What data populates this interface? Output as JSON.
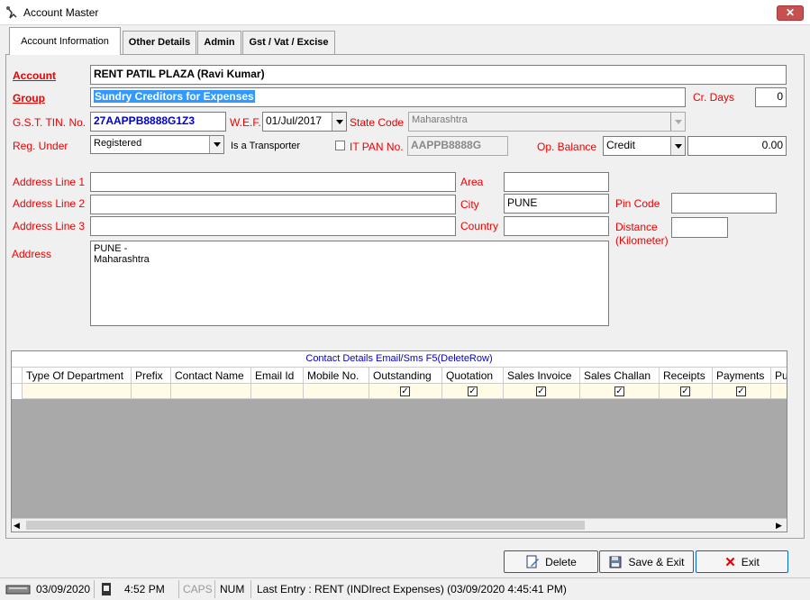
{
  "window": {
    "title": "Account Master",
    "close_label": "✕"
  },
  "tabs": [
    {
      "label": "Account Information"
    },
    {
      "label": "Other Details"
    },
    {
      "label": "Admin"
    },
    {
      "label": "Gst / Vat / Excise"
    }
  ],
  "form": {
    "account_label": "Account",
    "account_value": "RENT PATIL PLAZA (Ravi Kumar)",
    "group_label": "Group",
    "group_value": "Sundry Creditors for Expenses",
    "cr_days_label": "Cr. Days",
    "cr_days_value": "0",
    "gst_label": "G.S.T. TIN. No.",
    "gst_value": "27AAPPB8888G1Z3",
    "wef_label": "W.E.F.",
    "wef_value": "01/Jul/2017",
    "state_code_label": "State Code",
    "state_code_value": "Maharashtra",
    "reg_under_label": "Reg. Under",
    "reg_under_value": "Registered",
    "transporter_label": "Is a Transporter",
    "it_pan_label": "IT PAN No.",
    "it_pan_value": "AAPPB8888G",
    "op_balance_label": "Op. Balance",
    "op_balance_type": "Credit",
    "op_balance_value": "0.00",
    "address1_label": "Address Line 1",
    "address1_value": "",
    "address2_label": "Address Line 2",
    "address2_value": "",
    "address3_label": "Address Line 3",
    "address3_value": "",
    "area_label": "Area",
    "area_value": "",
    "city_label": "City",
    "city_value": "PUNE",
    "country_label": "Country",
    "country_value": "",
    "pincode_label": "Pin Code",
    "pincode_value": "",
    "distance_label": "Distance",
    "distance_unit_label": "(Kilometer)",
    "distance_value": "",
    "address_label": "Address",
    "address_line1": "PUNE -",
    "address_line2": "Maharashtra"
  },
  "contacts": {
    "title": "Contact Details Email/Sms F5(DeleteRow)",
    "columns": [
      "Type Of Department",
      "Prefix",
      "Contact Name",
      "Email Id",
      "Mobile No.",
      "Outstanding",
      "Quotation",
      "Sales Invoice",
      "Sales Challan",
      "Receipts",
      "Payments",
      "Pu"
    ]
  },
  "buttons": {
    "delete": "Delete",
    "save_exit": "Save & Exit",
    "exit": "Exit"
  },
  "status": {
    "date": "03/09/2020",
    "time": "4:52 PM",
    "caps": "CAPS",
    "num": "NUM",
    "last_entry": "Last Entry : RENT (INDIrect Expenses) (03/09/2020 4:45:41 PM)"
  }
}
